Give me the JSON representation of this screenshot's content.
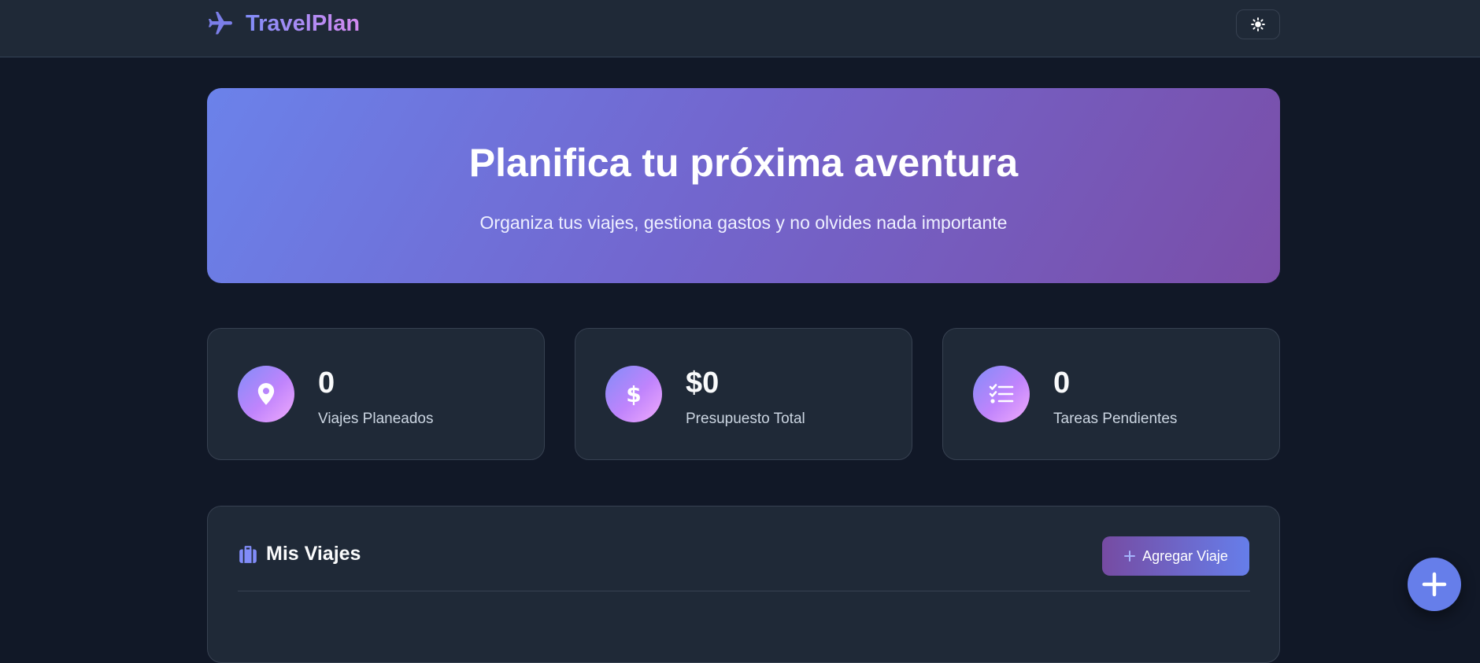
{
  "app": {
    "name": "TravelPlan"
  },
  "icons": {
    "brand": "airplane-icon",
    "theme_toggle": "sun-icon",
    "trips_header": "suitcase-icon",
    "add_button": "plus-icon",
    "fab": "plus-icon"
  },
  "hero": {
    "title": "Planifica tu próxima aventura",
    "subtitle": "Organiza tus viajes, gestiona gastos y no olvides nada importante"
  },
  "stats": [
    {
      "value": "0",
      "label": "Viajes Planeados",
      "icon": "map-pin-icon"
    },
    {
      "value": "$0",
      "label": "Presupuesto Total",
      "icon": "dollar-icon"
    },
    {
      "value": "0",
      "label": "Tareas Pendientes",
      "icon": "checklist-icon"
    }
  ],
  "trips": {
    "title": "Mis Viajes",
    "add_label": "Agregar Viaje"
  },
  "colors": {
    "background": "#111827",
    "card": "#1f2937",
    "accent": "#667eea",
    "accent_2": "#764ba2"
  }
}
